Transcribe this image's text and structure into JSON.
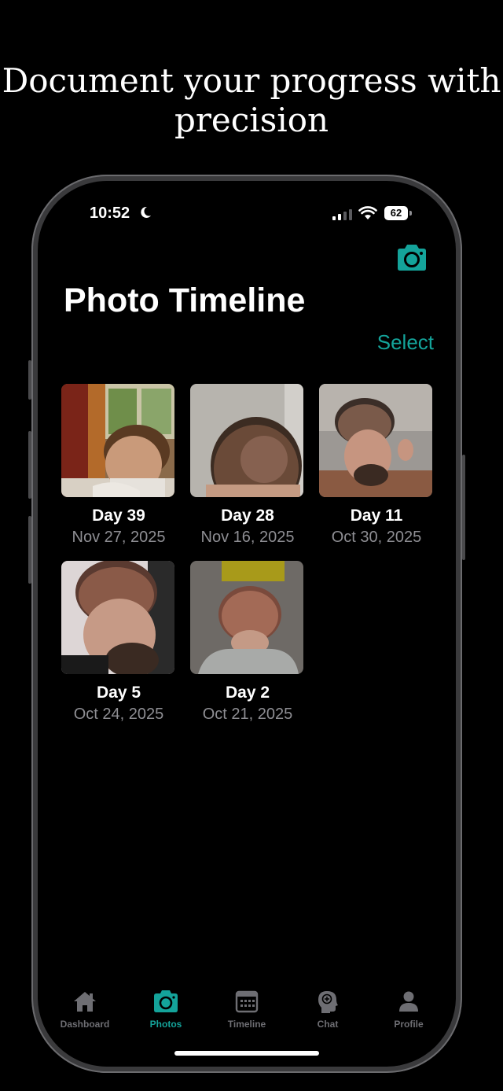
{
  "headline": "Document your progress with precision",
  "status_bar": {
    "time": "10:52",
    "battery": "62"
  },
  "page": {
    "title": "Photo Timeline",
    "select_label": "Select"
  },
  "photos": [
    {
      "day": "Day 39",
      "date": "Nov 27, 2025"
    },
    {
      "day": "Day 28",
      "date": "Nov 16, 2025"
    },
    {
      "day": "Day 11",
      "date": "Oct 30, 2025"
    },
    {
      "day": "Day 5",
      "date": "Oct 24, 2025"
    },
    {
      "day": "Day 2",
      "date": "Oct 21, 2025"
    }
  ],
  "tabs": [
    {
      "label": "Dashboard",
      "icon": "house-icon"
    },
    {
      "label": "Photos",
      "icon": "camera-icon",
      "active": true
    },
    {
      "label": "Timeline",
      "icon": "calendar-icon"
    },
    {
      "label": "Chat",
      "icon": "head-brain-icon"
    },
    {
      "label": "Profile",
      "icon": "person-icon"
    }
  ],
  "colors": {
    "accent": "#14a39a",
    "background": "#000000",
    "muted": "#8e8e93"
  }
}
